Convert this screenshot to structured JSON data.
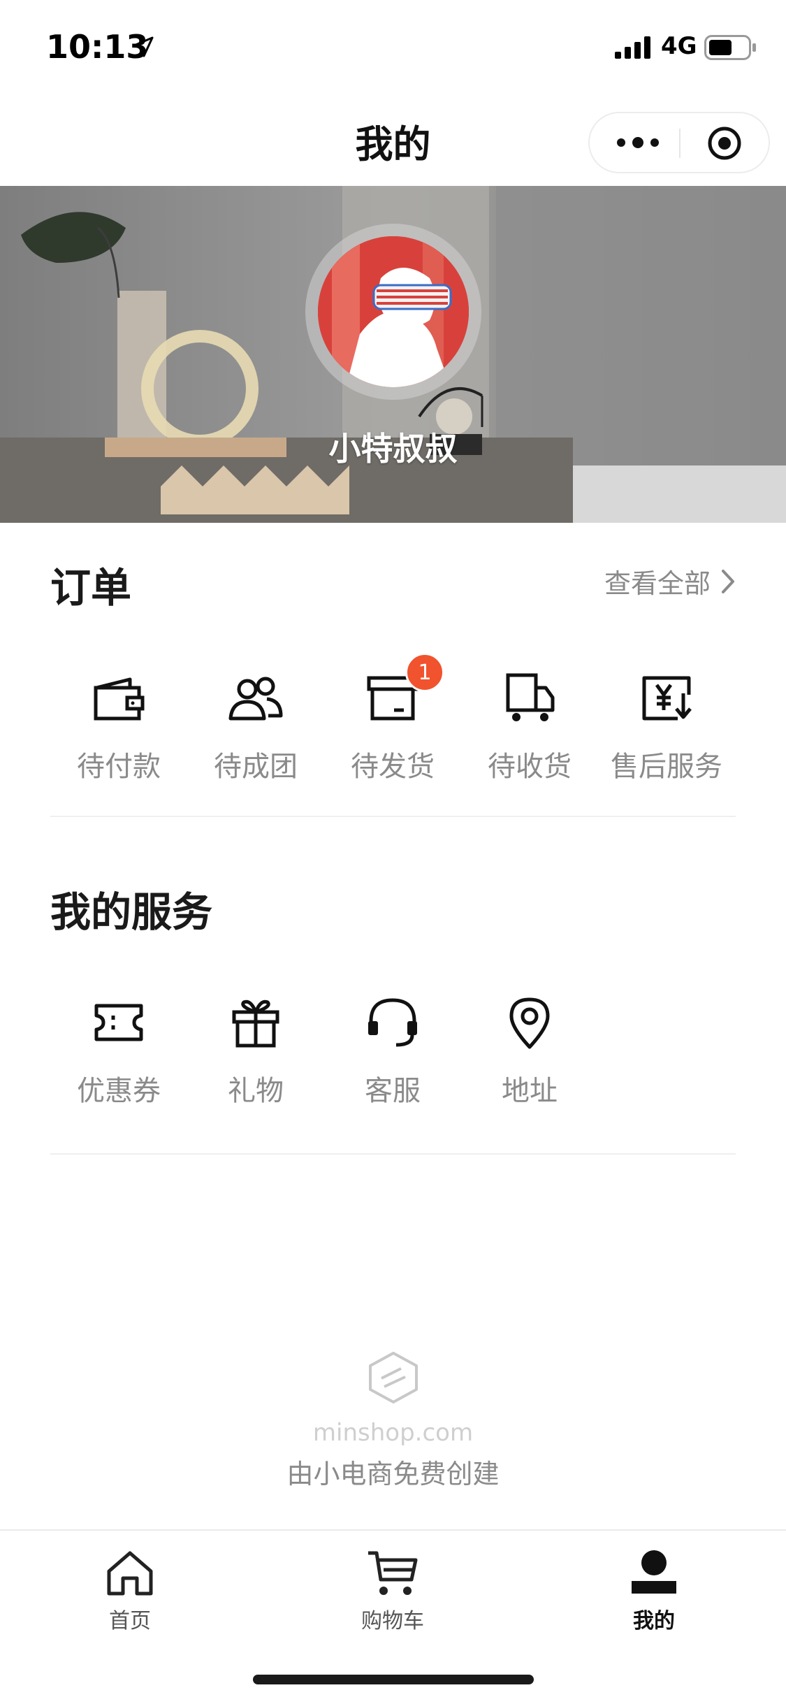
{
  "status_bar": {
    "time": "10:13",
    "network": "4G"
  },
  "nav": {
    "title": "我的"
  },
  "profile": {
    "nickname": "小特叔叔"
  },
  "orders": {
    "title": "订单",
    "view_all": "查看全部",
    "items": [
      {
        "label": "待付款",
        "icon": "wallet-icon"
      },
      {
        "label": "待成团",
        "icon": "group-icon"
      },
      {
        "label": "待发货",
        "icon": "package-box-icon",
        "badge": "1"
      },
      {
        "label": "待收货",
        "icon": "delivery-truck-icon"
      },
      {
        "label": "售后服务",
        "icon": "refund-yen-icon"
      }
    ]
  },
  "services": {
    "title": "我的服务",
    "items": [
      {
        "label": "优惠券",
        "icon": "ticket-icon"
      },
      {
        "label": "礼物",
        "icon": "gift-icon"
      },
      {
        "label": "客服",
        "icon": "headset-icon"
      },
      {
        "label": "地址",
        "icon": "location-pin-icon"
      }
    ]
  },
  "footer": {
    "domain": "minshop.com",
    "note": "由小电商免费创建"
  },
  "tabbar": {
    "items": [
      {
        "label": "首页",
        "icon": "home-icon"
      },
      {
        "label": "购物车",
        "icon": "cart-icon"
      },
      {
        "label": "我的",
        "icon": "user-icon",
        "active": true
      }
    ]
  },
  "colors": {
    "badge": "#f0532d",
    "muted_text": "#8a8a8a",
    "avatar_red": "#d63a3a"
  }
}
